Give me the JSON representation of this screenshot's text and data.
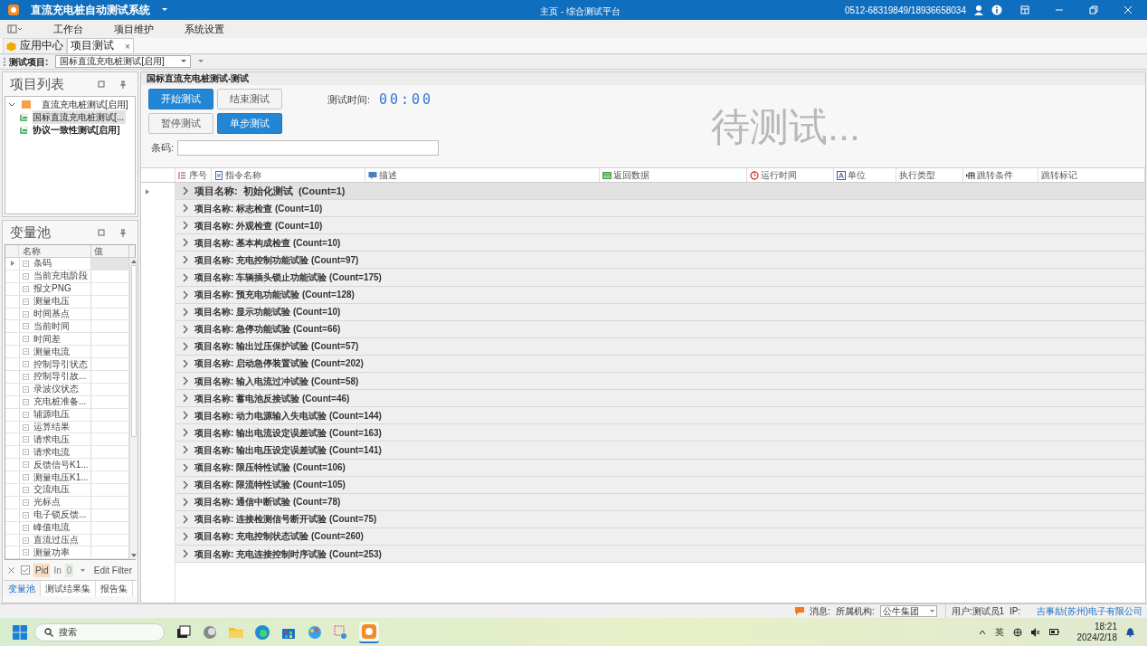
{
  "window": {
    "title": "直流充电桩自动测试系统",
    "breadcrumb": "主页 - 综合测试平台",
    "contact": "0512-68319849/18936658034"
  },
  "menu": [
    {
      "label": "工作台"
    },
    {
      "label": "项目维护"
    },
    {
      "label": "系统设置"
    }
  ],
  "tabs": [
    {
      "label": "应用中心",
      "selected": false
    },
    {
      "label": "项目测试",
      "selected": true,
      "close": "×"
    }
  ],
  "toolbar": {
    "label": "测试项目:",
    "value": "国标直流充电桩测试[启用]"
  },
  "project_list": {
    "title": "项目列表",
    "tree": [
      {
        "label": "直流充电桩测试[启用]",
        "expanded": true,
        "children": [
          {
            "label": "国标直流充电桩测试[...",
            "selected": true,
            "bold": false
          },
          {
            "label": "协议一致性测试[启用]",
            "selected": false,
            "bold": true
          }
        ]
      }
    ]
  },
  "variable_pool": {
    "title": "变量池",
    "columns": [
      "名称",
      "值"
    ],
    "rows": [
      {
        "name": "条码",
        "selected": true
      },
      {
        "name": "当前充电阶段",
        "selected": false
      },
      {
        "name": "报文PNG",
        "selected": false
      },
      {
        "name": "测量电压",
        "selected": false
      },
      {
        "name": "时间基点",
        "selected": false
      },
      {
        "name": "当前时间",
        "selected": false
      },
      {
        "name": "时间差",
        "selected": false
      },
      {
        "name": "测量电流",
        "selected": false
      },
      {
        "name": "控制导引状态",
        "selected": false
      },
      {
        "name": "控制导引故...",
        "selected": false
      },
      {
        "name": "录波仪状态",
        "selected": false
      },
      {
        "name": "充电桩准备...",
        "selected": false
      },
      {
        "name": "辅源电压",
        "selected": false
      },
      {
        "name": "运算结果",
        "selected": false
      },
      {
        "name": "请求电压",
        "selected": false
      },
      {
        "name": "请求电流",
        "selected": false
      },
      {
        "name": "反馈信号K1...",
        "selected": false
      },
      {
        "name": "测量电压K1...",
        "selected": false
      },
      {
        "name": "交流电压",
        "selected": false
      },
      {
        "name": "光标点",
        "selected": false
      },
      {
        "name": "电子锁反馈...",
        "selected": false
      },
      {
        "name": "峰值电流",
        "selected": false
      },
      {
        "name": "直流过压点",
        "selected": false
      },
      {
        "name": "测量功率",
        "selected": false
      }
    ],
    "filter": {
      "checked": true,
      "field": "Pid",
      "op": "In",
      "value": "0",
      "edit": "Edit Filter"
    },
    "tabs": [
      {
        "label": "变量池",
        "selected": true
      },
      {
        "label": "测试结果集",
        "selected": false
      },
      {
        "label": "报告集",
        "selected": false
      }
    ]
  },
  "test_panel": {
    "title": "国标直流充电桩测试-测试",
    "buttons": [
      {
        "label": "开始测试",
        "kind": "primary"
      },
      {
        "label": "结束测试",
        "kind": "default"
      },
      {
        "label": "暂停测试",
        "kind": "default"
      },
      {
        "label": "单步测试",
        "kind": "primary"
      }
    ],
    "time_label": "测试时间:",
    "time": "00:00",
    "status": "待测试...",
    "barcode_label": "条码:"
  },
  "grid": {
    "columns": [
      "序号",
      "指令名称",
      "描述",
      "返回数据",
      "运行时间",
      "单位",
      "执行类型",
      "跳转条件",
      "跳转标记"
    ],
    "groups": [
      {
        "label": "项目名称:  初始化测试  (Count=1)",
        "current": true
      },
      {
        "label": "项目名称: 标志检查 (Count=10)",
        "current": false
      },
      {
        "label": "项目名称: 外观检查 (Count=10)",
        "current": false
      },
      {
        "label": "项目名称: 基本构成检查 (Count=10)",
        "current": false
      },
      {
        "label": "项目名称: 充电控制功能试验 (Count=97)",
        "current": false
      },
      {
        "label": "项目名称: 车辆插头锁止功能试验 (Count=175)",
        "current": false
      },
      {
        "label": "项目名称: 预充电功能试验 (Count=128)",
        "current": false
      },
      {
        "label": "项目名称: 显示功能试验 (Count=10)",
        "current": false
      },
      {
        "label": "项目名称: 急停功能试验 (Count=66)",
        "current": false
      },
      {
        "label": "项目名称: 输出过压保护试验 (Count=57)",
        "current": false
      },
      {
        "label": "项目名称: 启动急停装置试验 (Count=202)",
        "current": false
      },
      {
        "label": "项目名称: 输入电流过冲试验 (Count=58)",
        "current": false
      },
      {
        "label": "项目名称: 蓄电池反接试验 (Count=46)",
        "current": false
      },
      {
        "label": "项目名称: 动力电源输入失电试验 (Count=144)",
        "current": false
      },
      {
        "label": "项目名称: 输出电流设定误差试验 (Count=163)",
        "current": false
      },
      {
        "label": "项目名称: 输出电压设定误差试验 (Count=141)",
        "current": false
      },
      {
        "label": "项目名称: 限压特性试验 (Count=106)",
        "current": false
      },
      {
        "label": "项目名称: 限流特性试验 (Count=105)",
        "current": false
      },
      {
        "label": "项目名称: 通信中断试验 (Count=78)",
        "current": false
      },
      {
        "label": "项目名称: 连接检测信号断开试验 (Count=75)",
        "current": false
      },
      {
        "label": "项目名称: 充电控制状态试验 (Count=260)",
        "current": false
      },
      {
        "label": "项目名称: 充电连接控制时序试验 (Count=253)",
        "current": false
      }
    ]
  },
  "status_bar": {
    "message_label": "消息:",
    "org_label": "所属机构:",
    "org": "公牛集团",
    "user": "用户:测试员1",
    "ip_label": "IP:",
    "company": "吉事励(苏州)电子有限公司"
  },
  "taskbar": {
    "search": "搜索",
    "ime": "英",
    "time": "18:21",
    "date": "2024/2/18"
  }
}
